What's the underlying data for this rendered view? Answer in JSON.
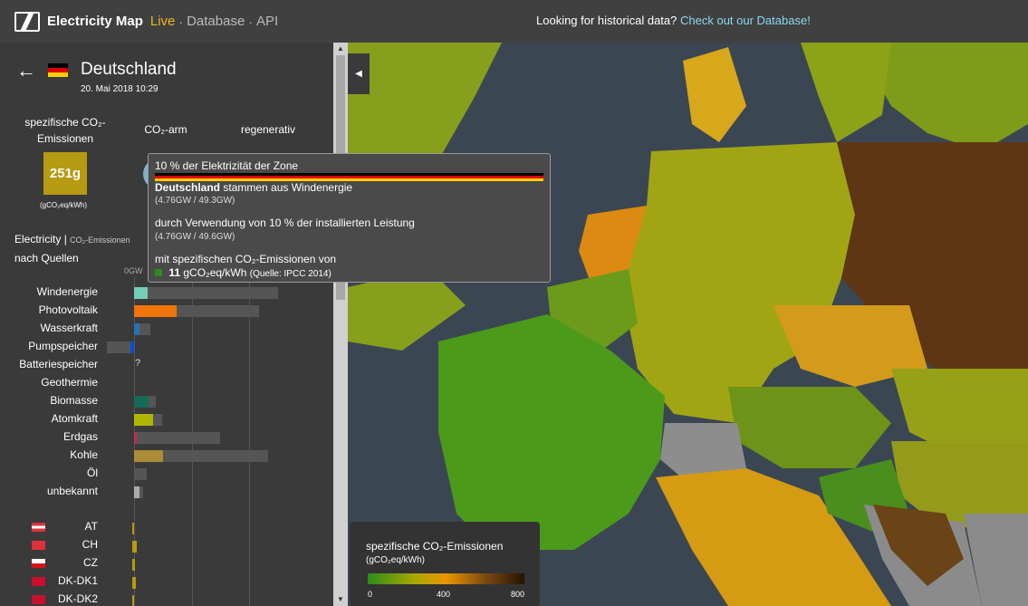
{
  "topbar": {
    "brand": "Electricity Map",
    "nav_live": "Live",
    "nav_database": "Database",
    "nav_api": "API",
    "message": "Looking for historical data?",
    "message_link": "Check out our Database!"
  },
  "zone": {
    "name": "Deutschland",
    "date": "20. Mai 2018 10:29"
  },
  "kpis": {
    "co2_label_line1": "spezifische CO₂-",
    "co2_label_line2": "Emissionen",
    "lowcarbon_label": "CO₂-arm",
    "renewable_label": "regenerativ",
    "co2_value": "251g",
    "co2_unit": "(gCO₂eq/kWh)"
  },
  "breakdown": {
    "title_main": "Electricity",
    "title_sep": "|",
    "title_sub": "CO₂-Emissionen",
    "title_line2": "nach Quellen",
    "axis_zero": "0GW",
    "colors": {
      "wind": "#74cdb9",
      "solar": "#f27406",
      "hydro": "#2772b2",
      "pumped": "#0052cc",
      "biomass": "#166a57",
      "nuclear": "#aeb800",
      "gas": "#bb2f51",
      "coal": "#ac8c35",
      "unknown": "#acacac"
    },
    "rows": [
      {
        "label": "Windenergie",
        "production": 4.76,
        "capacity": 49.3,
        "color_key": "wind"
      },
      {
        "label": "Photovoltaik",
        "production": 14.5,
        "capacity": 42.8,
        "color_key": "solar"
      },
      {
        "label": "Wasserkraft",
        "production": 1.8,
        "capacity": 5.6,
        "color_key": "hydro"
      },
      {
        "label": "Pumpspeicher",
        "production": -1.2,
        "capacity": 9.4,
        "color_key": "pumped"
      },
      {
        "label": "Batteriespeicher",
        "production": null,
        "capacity": null,
        "value_text": "?",
        "color_key": "unknown"
      },
      {
        "label": "Geothermie",
        "production": 0,
        "capacity": 0,
        "color_key": "unknown"
      },
      {
        "label": "Biomasse",
        "production": 4.9,
        "capacity": 7.4,
        "color_key": "biomass"
      },
      {
        "label": "Atomkraft",
        "production": 6.5,
        "capacity": 9.5,
        "color_key": "nuclear"
      },
      {
        "label": "Erdgas",
        "production": 1.0,
        "capacity": 29.5,
        "color_key": "gas"
      },
      {
        "label": "Kohle",
        "production": 9.8,
        "capacity": 46.0,
        "color_key": "coal"
      },
      {
        "label": "Öl",
        "production": 0,
        "capacity": 4.2,
        "color_key": "unknown"
      },
      {
        "label": "unbekannt",
        "production": 2.0,
        "capacity": 3.0,
        "color_key": "unknown"
      }
    ],
    "exchanges": [
      {
        "label": "AT",
        "value": 0.4
      },
      {
        "label": "CH",
        "value": 1.1
      },
      {
        "label": "CZ",
        "value": 0.5
      },
      {
        "label": "DK-DK1",
        "value": 0.9
      },
      {
        "label": "DK-DK2",
        "value": 0.3
      }
    ]
  },
  "tooltip": {
    "line1_pre": "10 % der Elektrizität der Zone",
    "line1_zone": "Deutschland",
    "line1_post": "stammen aus Windenergie",
    "line1_sub": "(4.76GW / 49.3GW)",
    "line2": "durch Verwendung von 10 % der installierten Leistung",
    "line2_sub": "(4.76GW / 49.6GW)",
    "line3": "mit spezifischen CO₂-Emissionen von",
    "line4_value": "11",
    "line4_unit": "gCO₂eq/kWh",
    "line4_source": "(Quelle: IPCC 2014)"
  },
  "legend": {
    "title": "spezifische CO₂-Emissionen",
    "unit": "(gCO₂eq/kWh)",
    "min": "0",
    "mid": "400",
    "max": "800"
  }
}
